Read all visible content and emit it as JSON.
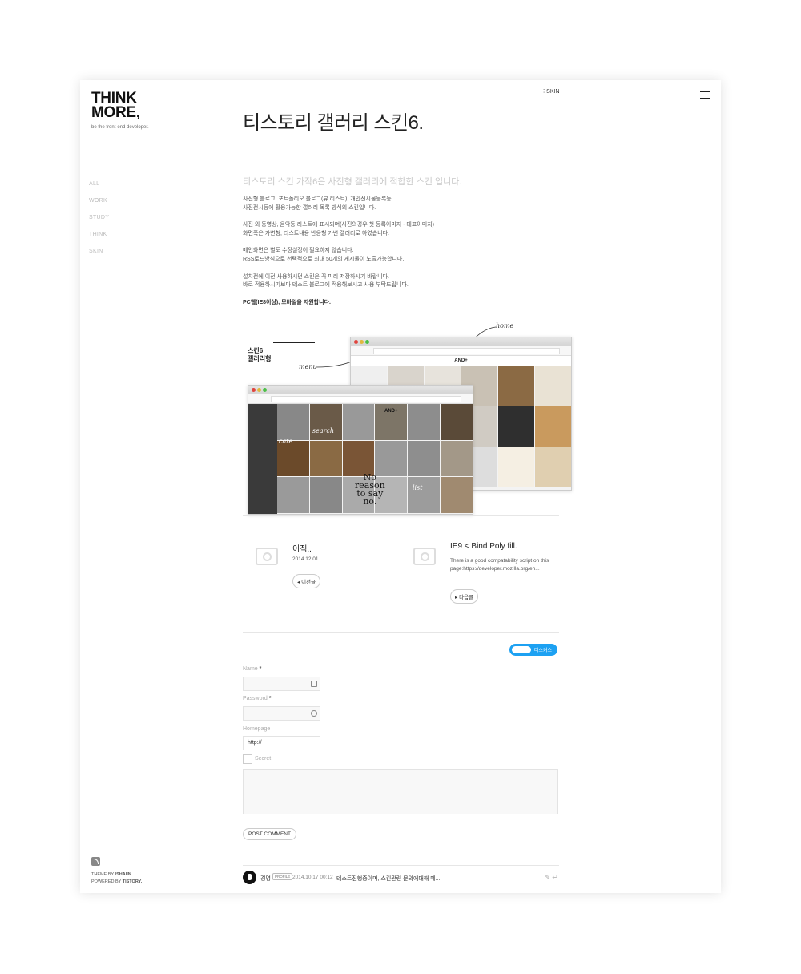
{
  "blog": {
    "logo_line1": "THINK",
    "logo_line2": "MORE,",
    "tagline": "be the front-end developer."
  },
  "nav": [
    "ALL",
    "WORK",
    "STUDY",
    "THINK",
    "SKIN"
  ],
  "header": {
    "skin_link": "⁝ SKIN",
    "menu_icon": "hamburger-icon"
  },
  "post": {
    "title": "티스토리 갤러리 스킨6.",
    "lead": "티스토리 스킨 가작6은 사진형 갤러리에 적합한 스킨 입니다.",
    "paragraphs": [
      [
        "사진형 블로그, 포트폴리오 블로그(뷰 리스트), 개인전시물등록등",
        "사진전시등에 활용가능한 갤러리 목록 방식의 스킨입니다."
      ],
      [
        "사진 외 동영상, 음악등 리스트에 표시되며(사진의경우 첫 등록이미지 - 대표이미지)",
        "화면폭은 가변형, 리스트내용 반응형 가변 갤러리로 하였습니다."
      ],
      [
        "메인화면은 별도 수정설정이 필요하지 않습니다.",
        "RSS로드방식으로 선택적으로 최대 50개의 게시물이 노출가능합니다."
      ],
      [
        "설치전에 이전 사용하시던 스킨은 꼭 미리 저장하시기 바랍니다.",
        "바로 적용하시기보다 테스트 블로그에 적용해보시고 사용 부탁드립니다."
      ],
      [
        "PC웹(IE8이상), 모바일을 지원합니다."
      ]
    ]
  },
  "figure": {
    "label_line1": "스킨6",
    "label_line2": "갤러리형",
    "note_home": "home",
    "note_menu": "menu",
    "note_category": "cate",
    "note_search": "search",
    "note_list": "list",
    "site_title": "AND+",
    "poster_text": [
      "No",
      "reason",
      "to say",
      "no."
    ]
  },
  "prev_next": {
    "prev": {
      "title": "이직..",
      "date": "2014.12.01",
      "button": "◂ 이전글"
    },
    "next": {
      "title": "IE9 < Bind Poly fill.",
      "description": "There is a good compatability script on this page:https://developer.mozilla.org/en...",
      "button": "▸ 다음글"
    }
  },
  "comment_form": {
    "toggle_label": "디스커스",
    "name_label": "Name",
    "password_label": "Password",
    "homepage_label": "Homepage",
    "homepage_value": "http://",
    "required_mark": "*",
    "secret_label": "Secret",
    "submit": "POST COMMENT"
  },
  "comments": [
    {
      "name": "경명",
      "badge": "PROFILE",
      "date": "2014.10.17 00:12",
      "text": "테스트진행중이며, 스킨관련 문의에대해 메..."
    }
  ],
  "footer": {
    "theme_prefix": "THEME BY",
    "theme_author": "ISHAIIN.",
    "powered_prefix": "POWERED BY",
    "powered_name": "TISTORY."
  }
}
